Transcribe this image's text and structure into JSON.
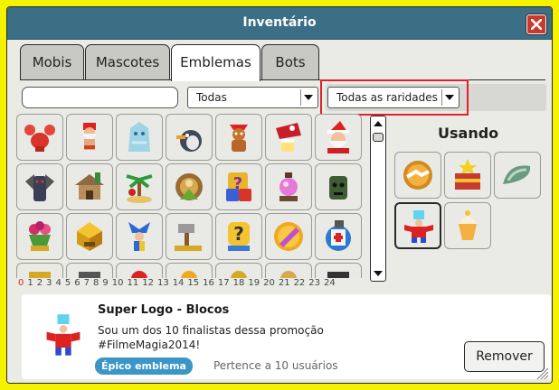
{
  "window": {
    "title": "Inventário"
  },
  "tabs": [
    {
      "label": "Mobis"
    },
    {
      "label": "Mascotes"
    },
    {
      "label": "Emblemas"
    },
    {
      "label": "Bots"
    }
  ],
  "filters": {
    "search_value": "",
    "category_selected": "Todas",
    "rarity_selected": "Todas as raridades"
  },
  "grid": {
    "badges": [
      "lobster-badge-icon",
      "santa-swimsuit-badge-icon",
      "ice-golem-badge-icon",
      "penguin-badge-icon",
      "gingerbread-badge-icon",
      "christmas-drink-badge-icon",
      "santa-badge-icon",
      "gargoyle-badge-icon",
      "safari-hut-badge-icon",
      "palm-island-badge-icon",
      "sultan-badge-icon",
      "question-dice-badge-icon",
      "crystal-ball-badge-icon",
      "mask-badge-icon",
      "rose-trophy-badge-icon",
      "golden-chest-badge-icon",
      "jester-badge-icon",
      "hammer-badge-icon",
      "question-trophy-badge-icon",
      "comb-coin-badge-icon",
      "ticket-badge-icon"
    ],
    "page_numbers": [
      "0",
      "1",
      "2",
      "3",
      "4",
      "5",
      "6",
      "7",
      "8",
      "9",
      "10",
      "11",
      "12",
      "13",
      "14",
      "15",
      "16",
      "17",
      "18",
      "19",
      "20",
      "21",
      "22",
      "23",
      "24"
    ],
    "current_page": "0"
  },
  "using": {
    "title": "Usando",
    "badges": [
      "handshake-badge-icon",
      "star-chest-badge-icon",
      "seashell-badge-icon",
      "super-logo-blocks-badge-icon",
      "cupcake-badge-icon"
    ]
  },
  "details": {
    "name": "Super Logo - Blocos",
    "description": "Sou um dos 10 finalistas dessa promoção #FilmeMagia2014!",
    "rarity": "Épico emblema",
    "owners": "Pertence a 10 usuários",
    "remove_label": "Remover"
  },
  "colors": {
    "frame": "#f5f200",
    "titlebar": "#3b6f86",
    "close": "#c83a2e",
    "highlight": "#e0202a",
    "rarity_pill": "#3b96c7"
  }
}
